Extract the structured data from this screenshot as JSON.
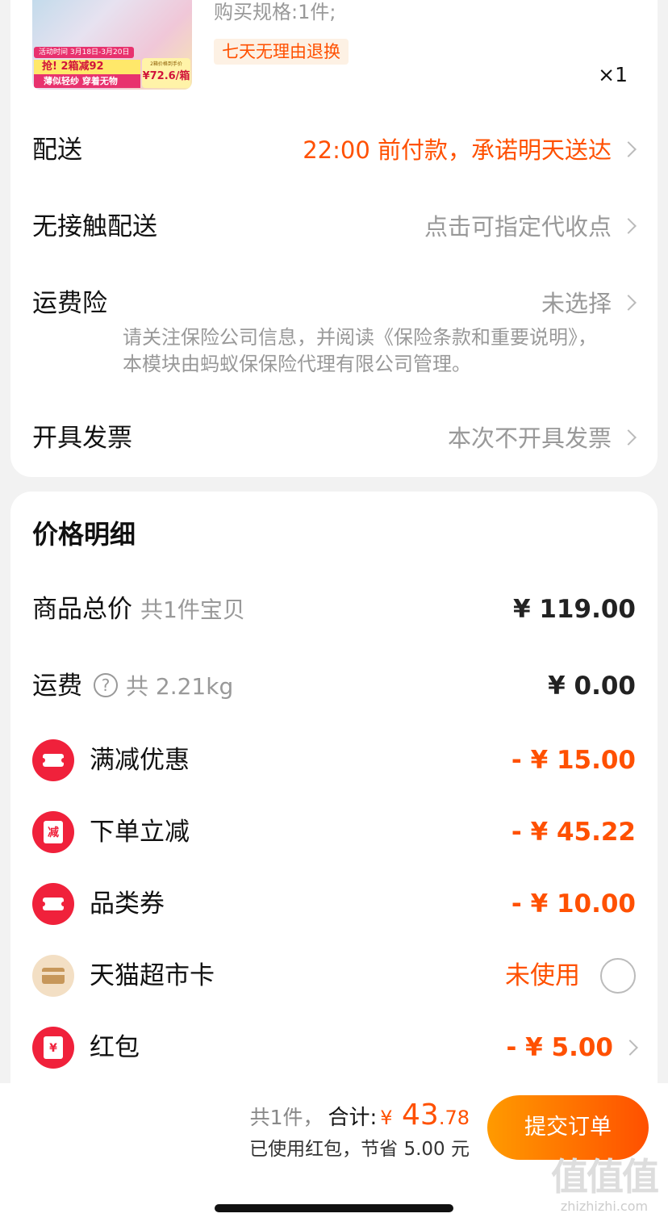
{
  "product": {
    "spec": "购买规格:1件;",
    "return_policy": "七天无理由退换",
    "quantity": "×1",
    "image": {
      "promo_date": "活动时间 3月18日-3月20日",
      "promo_main": "抢! 2箱减92",
      "promo_sub": "薄似轻纱 穿着无物",
      "price_note": "2箱价格到手价",
      "price": "¥72.6/箱"
    }
  },
  "delivery": {
    "label": "配送",
    "value": "22:00 前付款，承诺明天送达"
  },
  "contactless": {
    "label": "无接触配送",
    "value": "点击可指定代收点"
  },
  "shipping_insurance": {
    "label": "运费险",
    "value": "未选择",
    "note": "请关注保险公司信息，并阅读《保险条款和重要说明》，本模块由蚂蚁保保险代理有限公司管理。"
  },
  "invoice": {
    "label": "开具发票",
    "value": "本次不开具发票"
  },
  "price_detail": {
    "title": "价格明细",
    "items_total": {
      "label": "商品总价",
      "sub": "共1件宝贝",
      "value": "¥ 119.00"
    },
    "shipping": {
      "label": "运费",
      "help": "?",
      "sub": "共 2.21kg",
      "value": "¥ 0.00"
    },
    "full_discount": {
      "label": "满减优惠",
      "value": "- ¥ 15.00"
    },
    "order_discount": {
      "label": "下单立减",
      "icon_text": "减",
      "value": "- ¥ 45.22"
    },
    "category_coupon": {
      "label": "品类券",
      "value": "- ¥ 10.00"
    },
    "tmall_card": {
      "label": "天猫超市卡",
      "value": "未使用"
    },
    "red_packet": {
      "label": "红包",
      "icon_text": "¥",
      "value": "- ¥ 5.00"
    }
  },
  "bottom_bar": {
    "count": "共1件，",
    "total_label": "合计:",
    "currency": "¥",
    "total_int": " 43",
    "total_dec": ".78",
    "saved": "已使用红包，节省 5.00 元",
    "submit": "提交订单"
  },
  "watermark": {
    "logo": "值值值",
    "text": "zhizhizhi.com"
  },
  "colors": {
    "accent": "#ff5000",
    "red_icon": "#f0213b",
    "background": "#f2f2f2"
  }
}
